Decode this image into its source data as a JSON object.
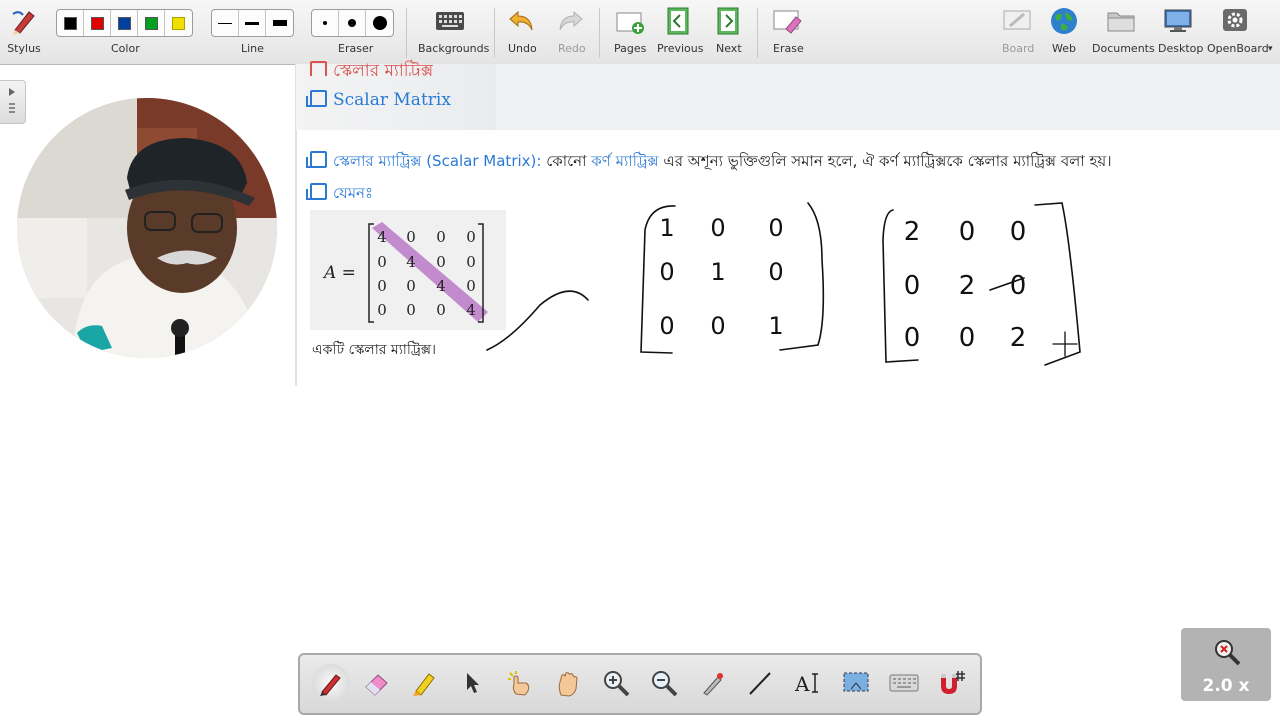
{
  "toolbar": {
    "stylus": "Stylus",
    "color": "Color",
    "line": "Line",
    "eraser": "Eraser",
    "backgrounds": "Backgrounds",
    "undo": "Undo",
    "redo": "Redo",
    "pages": "Pages",
    "previous": "Previous",
    "next": "Next",
    "erase": "Erase",
    "board": "Board",
    "web": "Web",
    "documents": "Documents",
    "desktop": "Desktop",
    "openboard": "OpenBoard",
    "colors": [
      "#000000",
      "#e00000",
      "#0040a0",
      "#00a020",
      "#f0e000"
    ]
  },
  "content": {
    "cut_heading": "স্কেলার ম্যাট্রিক্স",
    "title": "Scalar Matrix",
    "definition": {
      "term": "স্কেলার ম্যাট্রিক্স (Scalar Matrix):",
      "part1": " কোনো ",
      "link": "কর্ণ ম্যাট্রিক্স",
      "part2": " এর অশূন্য ভুক্তিগুলি সমান হলে, ঐ কর্ণ ম্যাট্রিক্সকে স্কেলার ম্যাট্রিক্স বলা হয়।"
    },
    "example_label": "যেমনঃ",
    "matrix_name": "A =",
    "matrix": [
      [
        "4",
        "0",
        "0",
        "0"
      ],
      [
        "0",
        "4",
        "0",
        "0"
      ],
      [
        "0",
        "0",
        "4",
        "0"
      ],
      [
        "0",
        "0",
        "0",
        "4"
      ]
    ],
    "caption": "একটি স্কেলার ম্যাট্রিক্স।",
    "handwritten_matrix_1": [
      [
        "1",
        "0",
        "0"
      ],
      [
        "0",
        "1",
        "0"
      ],
      [
        "0",
        "0",
        "1"
      ]
    ],
    "handwritten_matrix_2": [
      [
        "2",
        "0",
        "0"
      ],
      [
        "0",
        "2",
        "0"
      ],
      [
        "0",
        "0",
        "2"
      ]
    ]
  },
  "zoom": {
    "level": "2.0 x"
  }
}
